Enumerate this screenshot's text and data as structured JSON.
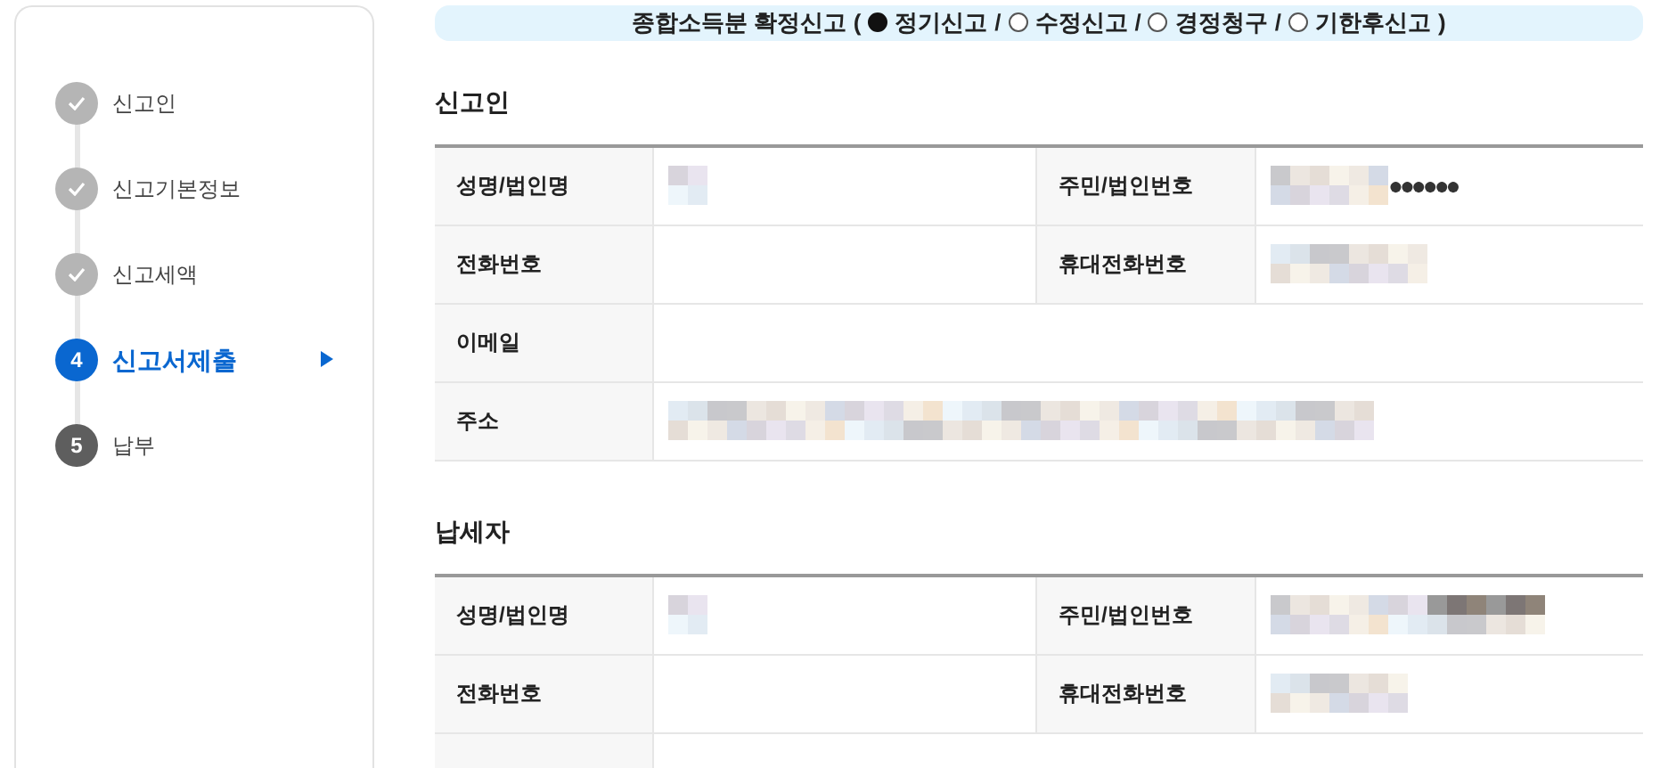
{
  "steps": [
    {
      "label": "신고인",
      "completed": true,
      "selected": false
    },
    {
      "label": "신고기본정보",
      "completed": true,
      "selected": false
    },
    {
      "label": "신고세액",
      "completed": true,
      "selected": false
    },
    {
      "number": "4",
      "label": "신고서제출",
      "completed": false,
      "selected": true
    },
    {
      "number": "5",
      "label": "납부",
      "completed": false,
      "selected": false
    }
  ],
  "banner": {
    "title": "종합소득분 확정신고 (",
    "options": [
      {
        "label": "정기신고",
        "selected": true,
        "after": "/"
      },
      {
        "label": "수정신고",
        "selected": false,
        "after": "/"
      },
      {
        "label": "경정청구",
        "selected": false,
        "after": "/"
      },
      {
        "label": "기한후신고",
        "selected": false,
        "after": ")"
      }
    ]
  },
  "sections": [
    {
      "title": "신고인",
      "rows": [
        {
          "kind": "pair",
          "fields": [
            {
              "label": "성명/법인명",
              "redacted": true
            },
            {
              "label": "주민/법인번호",
              "redacted": true,
              "masked": "●●●●●●"
            }
          ]
        },
        {
          "kind": "pair",
          "fields": [
            {
              "label": "전화번호",
              "redacted": false
            },
            {
              "label": "휴대전화번호",
              "redacted": true
            }
          ]
        },
        {
          "kind": "full",
          "fields": [
            {
              "label": "이메일",
              "redacted": false
            }
          ]
        },
        {
          "kind": "full",
          "fields": [
            {
              "label": "주소",
              "redacted": true
            }
          ]
        }
      ]
    },
    {
      "title": "납세자",
      "rows": [
        {
          "kind": "pair",
          "fields": [
            {
              "label": "성명/법인명",
              "redacted": true
            },
            {
              "label": "주민/법인번호",
              "redacted": true
            }
          ]
        },
        {
          "kind": "pair",
          "fields": [
            {
              "label": "전화번호",
              "redacted": false
            },
            {
              "label": "휴대전화번호",
              "redacted": true
            }
          ]
        }
      ]
    }
  ]
}
